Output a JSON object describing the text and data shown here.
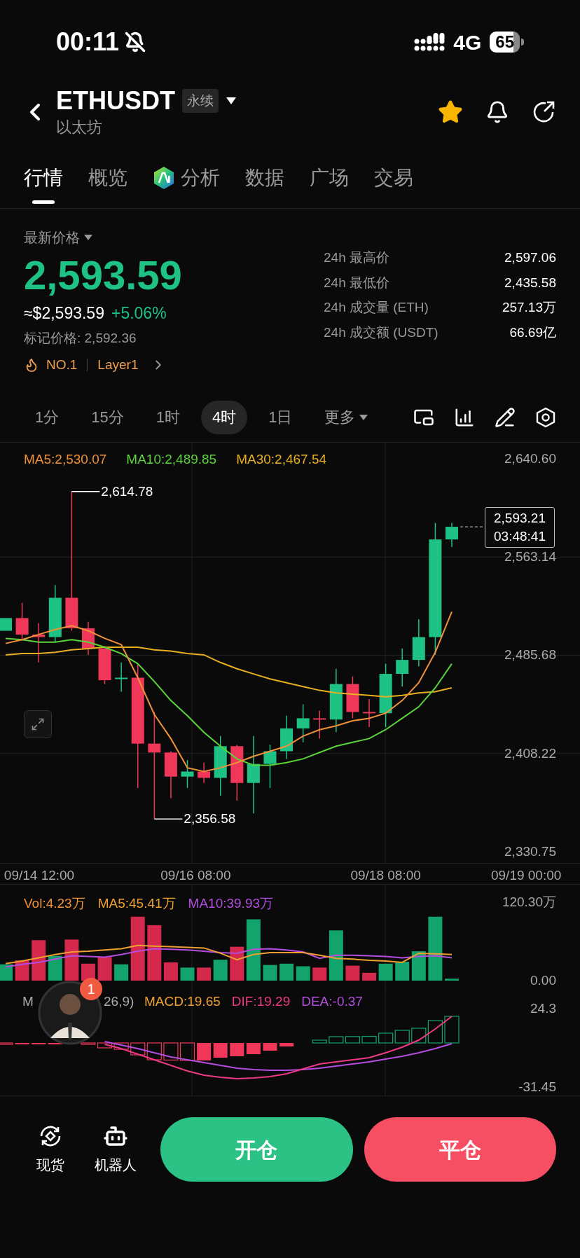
{
  "status_bar": {
    "time": "00:11",
    "network": "4G",
    "battery": "65"
  },
  "header": {
    "symbol": "ETHUSDT",
    "badge": "永续",
    "name": "以太坊",
    "favorite": true
  },
  "tabs": [
    {
      "label": "行情",
      "selected": true
    },
    {
      "label": "概览",
      "selected": false
    },
    {
      "label": "分析",
      "selected": false,
      "kind": "ai"
    },
    {
      "label": "数据",
      "selected": false
    },
    {
      "label": "广场",
      "selected": false
    },
    {
      "label": "交易",
      "selected": false
    }
  ],
  "price": {
    "label": "最新价格",
    "last": "2,593.59",
    "usd": "≈$2,593.59",
    "change": "+5.06%",
    "mark": "标记价格: 2,592.36",
    "rank": "NO.1",
    "tag": "Layer1"
  },
  "stats": [
    {
      "label": "24h 最高价",
      "value": "2,597.06"
    },
    {
      "label": "24h 最低价",
      "value": "2,435.58"
    },
    {
      "label": "24h 成交量 (ETH)",
      "value": "257.13万"
    },
    {
      "label": "24h 成交额 (USDT)",
      "value": "66.69亿"
    }
  ],
  "intervals": [
    {
      "label": "1分",
      "selected": false
    },
    {
      "label": "15分",
      "selected": false
    },
    {
      "label": "1时",
      "selected": false
    },
    {
      "label": "4时",
      "selected": true
    },
    {
      "label": "1日",
      "selected": false
    },
    {
      "label": "更多",
      "selected": false,
      "kind": "menu"
    }
  ],
  "chart": {
    "legend": [
      {
        "text": "MA5:2,530.07",
        "color": "#f0913a"
      },
      {
        "text": "MA10:2,489.85",
        "color": "#5ad43a"
      },
      {
        "text": "MA30:2,467.54",
        "color": "#e8b020"
      }
    ],
    "high_label": "2,614.78",
    "low_label": "2,356.58",
    "current_price": "2,593.21",
    "countdown": "03:48:41",
    "time_axis": [
      "09/14 12:00",
      "09/16 08:00",
      "09/18 08:00",
      "09/19 00:00"
    ],
    "chart_data": {
      "type": "line",
      "grid": true,
      "ylim": [
        2330.75,
        2640.6
      ],
      "categories": [
        null,
        null,
        null,
        null,
        null,
        null,
        null,
        null,
        null,
        null,
        null,
        null,
        null,
        null,
        null,
        null,
        null,
        null,
        null,
        null,
        null,
        null,
        null,
        null,
        null,
        null,
        null,
        null
      ],
      "yticks": [
        {
          "value": 2640.6,
          "label": "2,640.60"
        },
        {
          "value": 2563.14,
          "label": "2,563.14"
        },
        {
          "value": 2485.68,
          "label": "2,485.68"
        },
        {
          "value": 2408.22,
          "label": "2,408.22"
        },
        {
          "value": 2330.75,
          "label": "2,330.75"
        }
      ],
      "series": [
        {
          "color": "#e8b020",
          "values": [
            2486,
            2487,
            2487,
            2488,
            2490,
            2491,
            2492,
            2492,
            2492,
            2490,
            2489,
            2487,
            2486,
            2480,
            2475,
            2471,
            2467,
            2464,
            2461,
            2458,
            2456,
            2455,
            2454,
            2453,
            2454,
            2456,
            2457,
            2460
          ]
        },
        {
          "color": "#5ad43a",
          "values": [
            2499,
            2498,
            2496,
            2496,
            2498,
            2496,
            2492,
            2487,
            2479,
            2465,
            2450,
            2438,
            2425,
            2414,
            2404,
            2399,
            2399,
            2401,
            2404,
            2409,
            2414,
            2417,
            2420,
            2427,
            2436,
            2445,
            2460,
            2479
          ]
        },
        {
          "color": "#f0913a",
          "values": [
            2495,
            2498,
            2502,
            2506,
            2509,
            2505,
            2499,
            2494,
            2468,
            2439,
            2420,
            2397,
            2394,
            2397,
            2401,
            2406,
            2410,
            2414,
            2422,
            2427,
            2430,
            2434,
            2436,
            2440,
            2450,
            2464,
            2488,
            2520
          ]
        }
      ]
    }
  },
  "volume": {
    "legend": [
      {
        "text": "Vol:4.23万",
        "color": "#f0913a"
      },
      {
        "text": "MA5:45.41万",
        "color": "#f0a030"
      },
      {
        "text": "MA10:39.93万",
        "color": "#b44de0"
      }
    ],
    "bars": {
      "chart_data": {
        "type": "bar",
        "ylim": [
          0,
          120.3
        ],
        "categories": [
          null,
          null,
          null,
          null,
          null,
          null,
          null,
          null,
          null,
          null,
          null,
          null,
          null,
          null,
          null,
          null,
          null,
          null,
          null,
          null,
          null,
          null,
          null,
          null,
          null,
          null,
          null,
          null
        ],
        "yticks": [
          {
            "value": 120.3,
            "label": "120.30万"
          },
          {
            "value": 0,
            "label": "0.00"
          }
        ],
        "values": [
          25,
          31,
          62,
          38,
          63,
          26,
          36,
          25,
          98,
          85,
          28,
          20,
          20,
          32,
          52,
          94,
          24,
          26,
          22,
          20,
          77,
          23,
          12,
          26,
          29,
          45,
          98,
          3
        ],
        "colors": [
          "#12a46c",
          "#d4284c",
          "#d4284c",
          "#12a46c",
          "#d4284c",
          "#d4284c",
          "#d4284c",
          "#12a46c",
          "#d4284c",
          "#d4284c",
          "#d4284c",
          "#12a46c",
          "#d4284c",
          "#12a46c",
          "#d4284c",
          "#12a46c",
          "#12a46c",
          "#12a46c",
          "#12a46c",
          "#d4284c",
          "#12a46c",
          "#d4284c",
          "#d4284c",
          "#12a46c",
          "#12a46c",
          "#12a46c",
          "#12a46c",
          "#12a46c"
        ]
      }
    },
    "averages": {
      "chart_data": {
        "type": "line",
        "ylim": [
          0,
          120.3
        ],
        "categories": [
          null,
          null,
          null,
          null,
          null,
          null,
          null,
          null,
          null,
          null,
          null,
          null,
          null,
          null,
          null,
          null,
          null,
          null,
          null,
          null,
          null,
          null,
          null,
          null,
          null,
          null,
          null,
          null
        ],
        "series": [
          {
            "color": "#b44de0",
            "values": [
              21,
              25,
              28,
              33,
              38,
              37,
              36,
              40,
              45,
              49,
              48,
              47,
              45,
              43,
              42,
              48,
              49,
              47,
              44,
              34,
              39,
              39,
              38,
              37,
              35,
              37,
              38,
              35
            ]
          },
          {
            "color": "#f0a030",
            "values": [
              26,
              30,
              35,
              40,
              44,
              45,
              47,
              49,
              54,
              53,
              52,
              51,
              50,
              42,
              32,
              40,
              43,
              43,
              43,
              39,
              34,
              33,
              31,
              30,
              28,
              42,
              41,
              40
            ]
          }
        ]
      }
    }
  },
  "macd": {
    "fragments": [
      "M",
      "26,9)"
    ],
    "legend": [
      {
        "text": "MACD:19.65",
        "color": "#f0a030"
      },
      {
        "text": "DIF:19.29",
        "color": "#ee3a84"
      },
      {
        "text": "DEA:-0.37",
        "color": "#b44de0"
      }
    ],
    "histogram": {
      "chart_data": {
        "type": "bar",
        "ylim": [
          -31.45,
          24.3
        ],
        "categories": [
          null,
          null,
          null,
          null,
          null,
          null,
          null,
          null,
          null,
          null,
          null,
          null,
          null,
          null,
          null,
          null,
          null,
          null,
          null,
          null,
          null,
          null,
          null,
          null,
          null,
          null,
          null,
          null
        ],
        "yticks": [
          {
            "value": 24.3,
            "label": "24.3"
          },
          {
            "value": -31.45,
            "label": "-31.45"
          }
        ],
        "values": [
          -1,
          -1,
          -1,
          -1,
          null,
          -1,
          -3.5,
          -4.5,
          -8.5,
          -12,
          -12.2,
          -12.5,
          -12.5,
          -10.5,
          -9.5,
          -8,
          -5.5,
          -2.5,
          null,
          2,
          4.5,
          4.6,
          4.7,
          7,
          9,
          10.5,
          16,
          19
        ],
        "colors": [
          "#f0375a",
          "#f0375a",
          "#f0375a",
          "#f0375a",
          null,
          "#f0375a",
          "#f0375a",
          "#f0375a",
          "#f0375a",
          "#f0375a",
          "#f0375a",
          "#f0375a",
          "#f0375a",
          "#f0375a",
          "#f0375a",
          "#f0375a",
          "#f0375a",
          "#f0375a",
          null,
          "#12a46c",
          "#12a46c",
          "#12a46c",
          "#12a46c",
          "#12a46c",
          "#12a46c",
          "#12a46c",
          "#12a46c",
          "#12a46c"
        ]
      }
    },
    "signal_lines": {
      "chart_data": {
        "type": "line",
        "ylim": [
          -31.45,
          24.3
        ],
        "categories": [
          null,
          null,
          null,
          null,
          null,
          null,
          null,
          null,
          null,
          null,
          null,
          null,
          null,
          null,
          null,
          null,
          null,
          null,
          null,
          null,
          null,
          null
        ],
        "series": [
          {
            "color": "#b44de0",
            "values": [
              1,
              -1.5,
              -4,
              -7,
              -10,
              -12,
              -14,
              -16,
              -18,
              -19,
              -19.5,
              -19.5,
              -19,
              -18,
              -16.5,
              -15,
              -13.5,
              -11.5,
              -9.5,
              -7,
              -4,
              -0.5
            ]
          },
          {
            "color": "#ee3a84",
            "values": [
              -1,
              -4,
              -8,
              -12,
              -16,
              -20,
              -23,
              -24.5,
              -25.5,
              -25,
              -24,
              -22,
              -18.5,
              -15,
              -13.5,
              -12,
              -10.5,
              -7,
              -3,
              2,
              10,
              19
            ]
          }
        ]
      }
    }
  },
  "assistant": {
    "badge": "1"
  },
  "bottom_bar": {
    "shortcuts": [
      {
        "label": "现货",
        "kind": "spot"
      },
      {
        "label": "机器人",
        "kind": "robot"
      }
    ],
    "buttons": [
      {
        "label": "开仓",
        "kind": "open"
      },
      {
        "label": "平仓",
        "kind": "close"
      }
    ]
  }
}
